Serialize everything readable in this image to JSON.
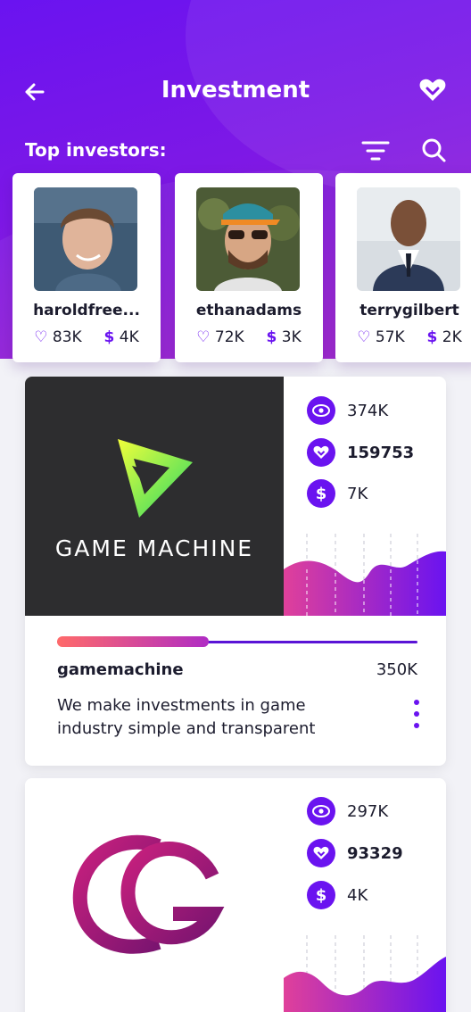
{
  "header": {
    "title": "Investment",
    "back_icon": "arrow-left-icon",
    "favorite_icon": "heart-icon"
  },
  "investors_section": {
    "label": "Top investors:",
    "filter_icon": "filter-icon",
    "search_icon": "search-icon"
  },
  "investors": [
    {
      "name": "haroldfree...",
      "likes": "83K",
      "amount": "4K"
    },
    {
      "name": "ethanadams",
      "likes": "72K",
      "amount": "3K"
    },
    {
      "name": "terrygilbert",
      "likes": "57K",
      "amount": "2K"
    }
  ],
  "projects": [
    {
      "logo_text": "GAME MACHINE",
      "views": "374K",
      "likes": "159753",
      "investment": "7K",
      "progress": 0.42,
      "name": "gamemachine",
      "goal": "350K",
      "description": "We make investments in game industry simple and transparent"
    },
    {
      "views": "297K",
      "likes": "93329",
      "investment": "4K"
    }
  ],
  "colors": {
    "accent": "#6a13f0",
    "hero_start": "#6a13f0",
    "hero_end": "#a020c8",
    "progress_start": "#ff6a6a",
    "progress_end": "#b02cc4"
  }
}
